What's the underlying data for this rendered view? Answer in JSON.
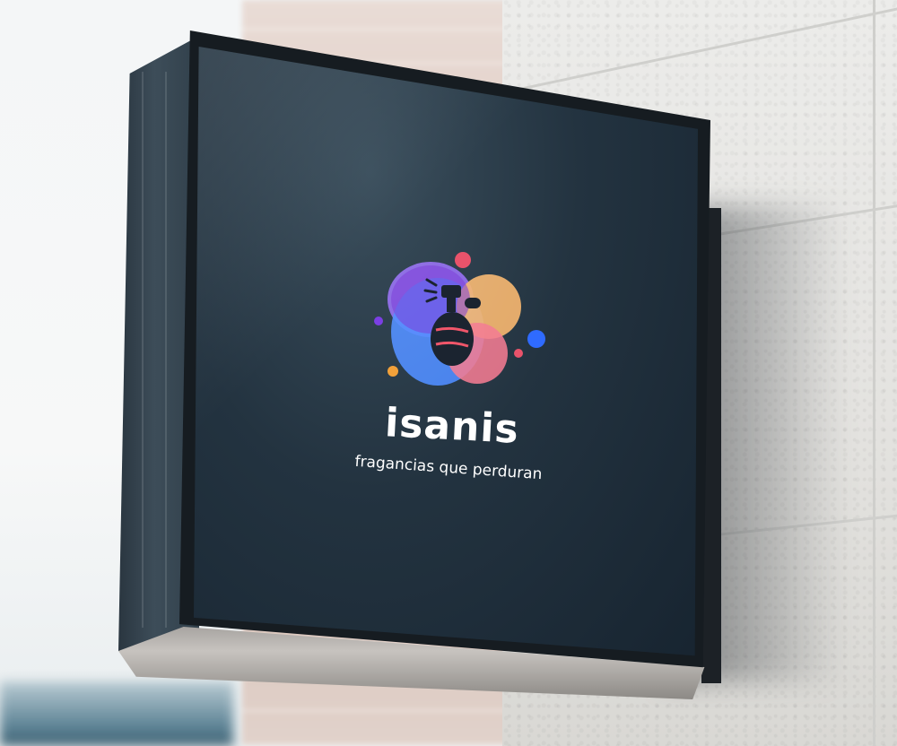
{
  "sign": {
    "brand_name": "isanis",
    "tagline": "fragancias que perduran",
    "logo": "perfume-bottle-icon",
    "colors": {
      "sign_face": "#1f2f3b",
      "frame": "#161c21",
      "text": "#ffffff",
      "purple": "#7b3fe4",
      "blue": "#2f6bff",
      "orange": "#f2a13a",
      "pink": "#f0566a",
      "coral_dot": "#e9536b"
    }
  }
}
